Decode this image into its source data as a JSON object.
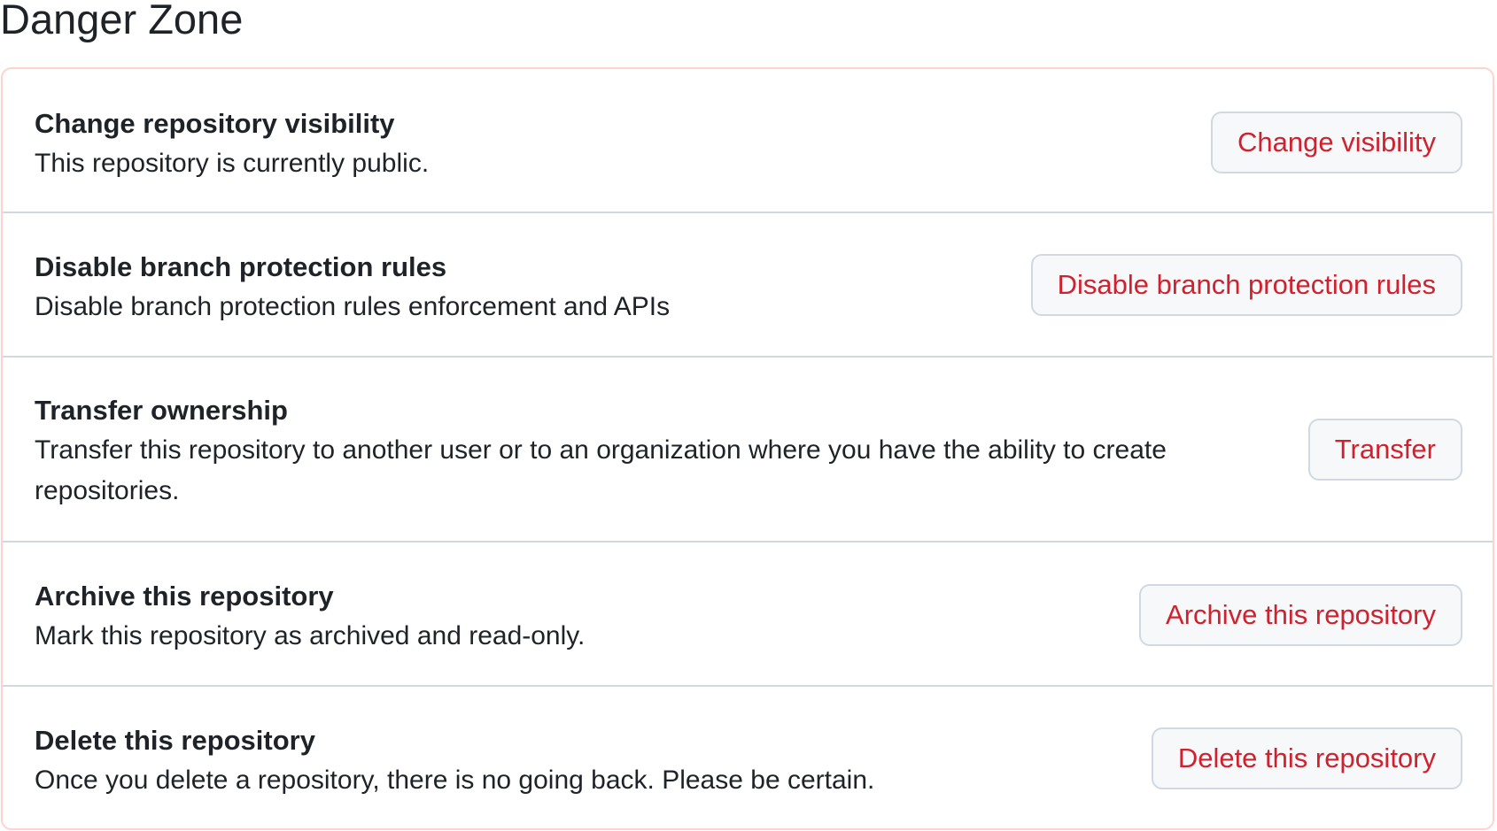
{
  "page": {
    "title": "Danger Zone"
  },
  "colors": {
    "danger_text": "#cf222e",
    "danger_border": "#ffd2d0",
    "row_divider": "#d1d9e0",
    "button_bg": "#f6f8fa",
    "text_primary": "#1f2328"
  },
  "rows": [
    {
      "title": "Change repository visibility",
      "description": "This repository is currently public.",
      "button_label": "Change visibility"
    },
    {
      "title": "Disable branch protection rules",
      "description": "Disable branch protection rules enforcement and APIs",
      "button_label": "Disable branch protection rules"
    },
    {
      "title": "Transfer ownership",
      "description": "Transfer this repository to another user or to an organization where you have the ability to create repositories.",
      "button_label": "Transfer"
    },
    {
      "title": "Archive this repository",
      "description": "Mark this repository as archived and read-only.",
      "button_label": "Archive this repository"
    },
    {
      "title": "Delete this repository",
      "description": "Once you delete a repository, there is no going back. Please be certain.",
      "button_label": "Delete this repository"
    }
  ]
}
